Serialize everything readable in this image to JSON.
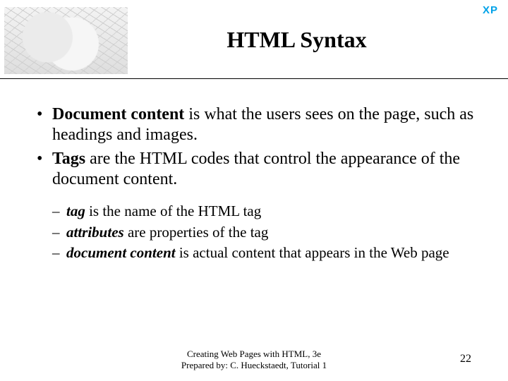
{
  "badge": "XP",
  "title": "HTML Syntax",
  "bullets": [
    {
      "strong": "Document content",
      "rest": " is what the users sees on the page, such as headings and images."
    },
    {
      "strong": "Tags",
      "rest": " are the HTML codes that control the appearance of the document content."
    }
  ],
  "subbullets": [
    {
      "emph": "tag",
      "rest": " is the name of the HTML tag"
    },
    {
      "emph": "attributes",
      "rest": " are properties of the tag"
    },
    {
      "emph": "document content",
      "rest": " is actual content that appears in the Web page"
    }
  ],
  "footer": {
    "line1": "Creating Web Pages with HTML, 3e",
    "line2": "Prepared by: C. Hueckstaedt, Tutorial 1"
  },
  "page_number": "22"
}
